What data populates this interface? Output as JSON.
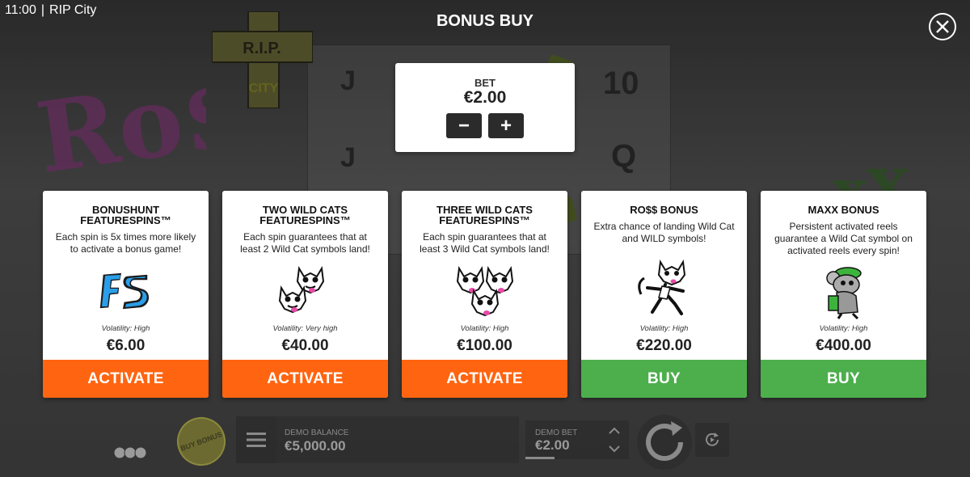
{
  "status": {
    "time": "11:00",
    "app": "RIP City"
  },
  "header": {
    "title": "BONUS BUY"
  },
  "bet": {
    "label": "BET",
    "value": "€2.00",
    "minus": "−",
    "plus": "+"
  },
  "background": {
    "cross_top": "R.I.P.",
    "cross_bottom": "CITY"
  },
  "cards": [
    {
      "title": "BONUSHUNT\nFEATURESPINS™",
      "desc": "Each spin is 5x times more likely to activate a bonus game!",
      "icon": "fs-logo-icon",
      "volatility": "Volatility: High",
      "price": "€6.00",
      "action": "ACTIVATE",
      "action_color": "#ff6410"
    },
    {
      "title": "TWO WILD CATS\nFEATURESPINS™",
      "desc": "Each spin guarantees that at least 2 Wild Cat symbols land!",
      "icon": "two-cats-icon",
      "volatility": "Volatility: Very high",
      "price": "€40.00",
      "action": "ACTIVATE",
      "action_color": "#ff6410"
    },
    {
      "title": "THREE WILD CATS\nFEATURESPINS™",
      "desc": "Each spin guarantees that at least 3 Wild Cat symbols land!",
      "icon": "three-cats-icon",
      "volatility": "Volatility: High",
      "price": "€100.00",
      "action": "ACTIVATE",
      "action_color": "#ff6410"
    },
    {
      "title": "RO$$ BONUS",
      "desc": "Extra chance of landing Wild Cat and WILD symbols!",
      "icon": "ross-cat-icon",
      "volatility": "Volatility: High",
      "price": "€220.00",
      "action": "BUY",
      "action_color": "#4caf4c"
    },
    {
      "title": "MAXX BONUS",
      "desc": "Persistent activated reels guarantee a Wild Cat symbol on activated reels every spin!",
      "icon": "maxx-rat-icon",
      "volatility": "Volatility: High",
      "price": "€400.00",
      "action": "BUY",
      "action_color": "#4caf4c"
    }
  ],
  "bottom": {
    "buy_bonus": "BUY BONUS",
    "balance_label": "DEMO BALANCE",
    "balance_value": "€5,000.00",
    "demo_bet_label": "DEMO BET",
    "demo_bet_value": "€2.00"
  }
}
